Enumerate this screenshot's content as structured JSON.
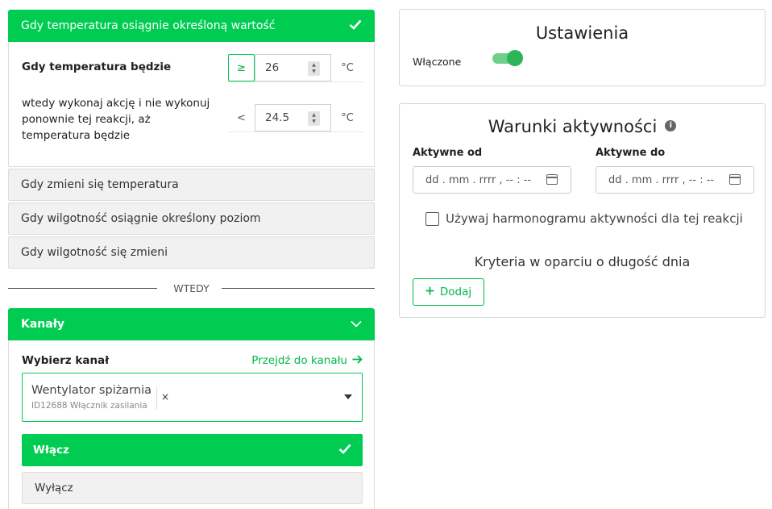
{
  "trigger": {
    "active_title": "Gdy temperatura osiągnie określoną wartość",
    "row1_label": "Gdy temperatura będzie",
    "row1_operator": "≥",
    "row1_value": "26",
    "row1_unit": "°C",
    "row2_label": "wtedy wykonaj akcję i nie wykonuj ponownie tej reakcji, aż temperatura będzie",
    "row2_operator": "<",
    "row2_value": "24.5",
    "row2_unit": "°C",
    "collapsed": [
      "Gdy zmieni się temperatura",
      "Gdy wilgotność osiągnie określony poziom",
      "Gdy wilgotność się zmieni"
    ]
  },
  "divider": "WTEDY",
  "channels": {
    "title": "Kanały",
    "choose_label": "Wybierz kanał",
    "go_link": "Przejdź do kanału",
    "selected_name": "Wentylator spiżarnia",
    "selected_sub": "ID12688 Włącznik zasilania",
    "clear": "×",
    "option_on": "Włącz",
    "option_off": "Wyłącz"
  },
  "settings": {
    "title": "Ustawienia",
    "enabled_label": "Włączone",
    "enabled": true
  },
  "activity": {
    "title": "Warunki aktywności",
    "from_label": "Aktywne od",
    "to_label": "Aktywne do",
    "from_placeholder": "dd . mm . rrrr ,  -- : --",
    "to_placeholder": "dd . mm . rrrr ,  -- : --",
    "schedule_label": "Używaj harmonogramu aktywności dla tej reakcji",
    "criteria_title": "Kryteria w oparciu o długość dnia",
    "add_label": "Dodaj"
  },
  "colors": {
    "accent": "#00cc52",
    "toggle_on": "#2fb457"
  }
}
